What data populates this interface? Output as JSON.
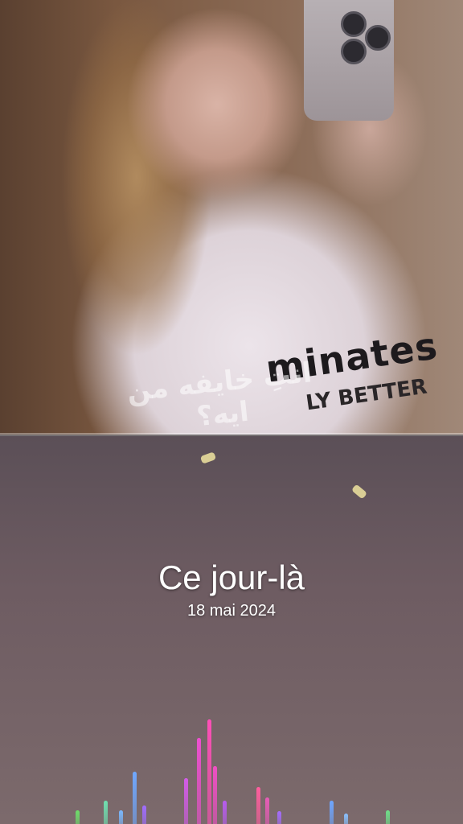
{
  "story": {
    "arabic_caption": "انتِ خايفه من ايه؟",
    "shirt_text": "minates",
    "shirt_subtext": "LY BETTER",
    "memory_title": "Ce jour-là",
    "memory_date": "18 mai 2024"
  },
  "visualizer": {
    "bars": [
      {
        "value": 0.13,
        "color": "#6dde6a"
      },
      {
        "value": 0.22,
        "color": "#6fe0b0"
      },
      {
        "value": 0.13,
        "color": "#7ab8ff"
      },
      {
        "value": 0.5,
        "color": "#6fa8ff"
      },
      {
        "value": 0.18,
        "color": "#a06cff"
      },
      {
        "value": 0.44,
        "color": "#d35ce8"
      },
      {
        "value": 0.82,
        "color": "#ee4fd0"
      },
      {
        "value": 1.0,
        "color": "#ff4fb8"
      },
      {
        "value": 0.55,
        "color": "#f04fc4"
      },
      {
        "value": 0.22,
        "color": "#b85cf0"
      },
      {
        "value": 0.35,
        "color": "#ff5e9e"
      },
      {
        "value": 0.25,
        "color": "#e85cb8"
      },
      {
        "value": 0.12,
        "color": "#a56cff"
      },
      {
        "value": 0.22,
        "color": "#6ea6ff"
      },
      {
        "value": 0.1,
        "color": "#8ac0ff"
      },
      {
        "value": 0.13,
        "color": "#6fe08a"
      }
    ]
  }
}
